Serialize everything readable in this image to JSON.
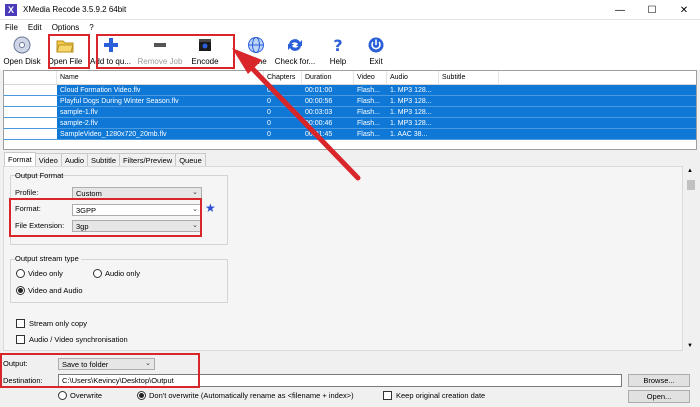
{
  "window": {
    "title": "XMedia Recode 3.5.9.2 64bit",
    "icon": "X",
    "controls": [
      "—",
      "☐",
      "✕"
    ]
  },
  "menu": [
    "File",
    "Edit",
    "Options",
    "?"
  ],
  "toolbar": {
    "open_disk": "Open Disk",
    "open_file": "Open File",
    "add_to_queue": "Add to qu...",
    "remove_job": "Remove Job",
    "encode": "Encode",
    "home": "Home",
    "check_updates": "Check for...",
    "help": "Help",
    "exit": "Exit"
  },
  "filelist": {
    "columns": [
      "Name",
      "Chapters",
      "Duration",
      "Video",
      "Audio",
      "Subtitle"
    ],
    "rows": [
      {
        "name": "Cloud Formation Video.flv",
        "chapters": "0",
        "duration": "00:01:00",
        "video": "Flash...",
        "audio": "1. MP3 128..."
      },
      {
        "name": "Playful Dogs During Winter Season.flv",
        "chapters": "0",
        "duration": "00:00:56",
        "video": "Flash...",
        "audio": "1. MP3 128..."
      },
      {
        "name": "sample-1.flv",
        "chapters": "0",
        "duration": "00:03:03",
        "video": "Flash...",
        "audio": "1. MP3 128..."
      },
      {
        "name": "sample-2.flv",
        "chapters": "0",
        "duration": "00:00:46",
        "video": "Flash...",
        "audio": "1. MP3 128..."
      },
      {
        "name": "SampleVideo_1280x720_20mb.flv",
        "chapters": "0",
        "duration": "00:01:45",
        "video": "Flash...",
        "audio": "1. AAC 38..."
      }
    ]
  },
  "tabs": [
    "Format",
    "Video",
    "Audio",
    "Subtitle",
    "Filters/Preview",
    "Queue"
  ],
  "format_panel": {
    "output_format_title": "Output Format",
    "profile_label": "Profile:",
    "profile_value": "Custom",
    "format_label": "Format:",
    "format_value": "3GPP",
    "extension_label": "File Extension:",
    "extension_value": "3gp",
    "stream_type_title": "Output stream type",
    "video_only": "Video only",
    "audio_only": "Audio only",
    "video_and_audio": "Video and Audio",
    "stream_only_copy": "Stream only copy",
    "av_sync": "Audio / Video synchronisation"
  },
  "output": {
    "output_label": "Output:",
    "output_value": "Save to folder",
    "destination_label": "Destination:",
    "destination_value": "C:\\Users\\Kevincy\\Desktop\\Output",
    "browse": "Browse...",
    "open": "Open...",
    "overwrite": "Overwrite",
    "dont_overwrite": "Don't overwrite (Automatically rename as <filename + index>)",
    "keep_creation_date": "Keep original creation date"
  },
  "colors": {
    "selection": "#0f78d7",
    "annotation_red": "#d9262b"
  }
}
